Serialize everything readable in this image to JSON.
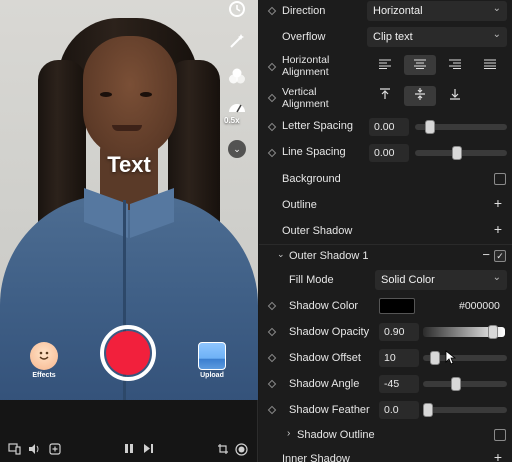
{
  "preview": {
    "overlay_text": "Text",
    "speed_label": "0.5x",
    "effects_label": "Effects",
    "upload_label": "Upload",
    "record_color": "#f2203c",
    "tools": [
      "timer-icon",
      "magic-wand-icon",
      "filters-icon",
      "speed-icon",
      "chevron-down-icon"
    ],
    "bottom_icons": [
      "devices-icon",
      "volume-icon",
      "add-media-icon",
      "pause-icon",
      "skip-next-icon",
      "crop-icon",
      "record-dot-icon"
    ]
  },
  "panel": {
    "direction": {
      "label": "Direction",
      "value": "Horizontal"
    },
    "overflow": {
      "label": "Overflow",
      "value": "Clip text"
    },
    "h_align": {
      "label": "Horizontal Alignment",
      "line1": "Horizontal",
      "line2": "Alignment",
      "options": [
        "align-left-icon",
        "align-center-icon",
        "align-right-icon",
        "align-justify-icon"
      ],
      "selected": 1
    },
    "v_align": {
      "label": "Vertical Alignment",
      "line1": "Vertical",
      "line2": "Alignment",
      "options": [
        "align-top-icon",
        "align-middle-icon",
        "align-bottom-icon"
      ],
      "selected": 1
    },
    "letter_spacing": {
      "label": "Letter Spacing",
      "value": "0.00",
      "level": 0.12
    },
    "line_spacing": {
      "label": "Line Spacing",
      "value": "0.00",
      "level": 0.45
    },
    "background": {
      "label": "Background",
      "checked": false
    },
    "outline": {
      "label": "Outline"
    },
    "outer_shadow": {
      "label": "Outer Shadow"
    },
    "outer_shadow_1": {
      "label": "Outer Shadow 1",
      "checked": true,
      "fill_mode": {
        "label": "Fill Mode",
        "value": "Solid Color"
      },
      "shadow_color": {
        "label": "Shadow Color",
        "hex": "#000000",
        "swatch": "#000000"
      },
      "shadow_opacity": {
        "label": "Shadow Opacity",
        "value": "0.90",
        "level": 0.9
      },
      "shadow_offset": {
        "label": "Shadow Offset",
        "value": "10",
        "level": 0.1
      },
      "shadow_angle": {
        "label": "Shadow Angle",
        "value": "-45",
        "level": 0.375
      },
      "shadow_feather": {
        "label": "Shadow Feather",
        "value": "0.0",
        "level": 0.0
      },
      "shadow_outline": {
        "label": "Shadow Outline",
        "checked": false
      }
    },
    "inner_shadow": {
      "label": "Inner Shadow"
    }
  }
}
